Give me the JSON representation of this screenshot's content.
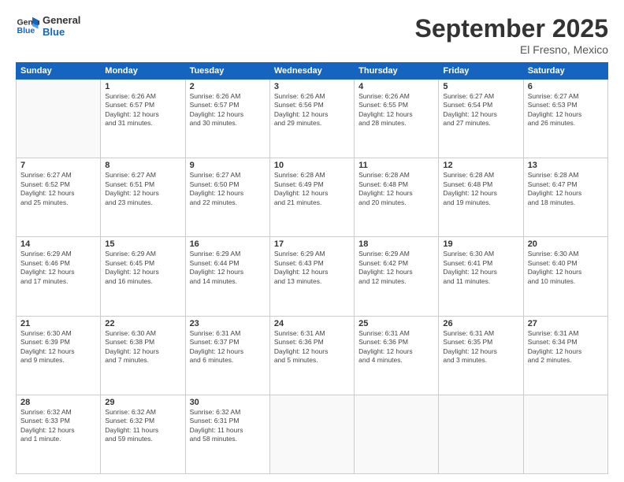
{
  "header": {
    "logo_general": "General",
    "logo_blue": "Blue",
    "month_year": "September 2025",
    "location": "El Fresno, Mexico"
  },
  "days_of_week": [
    "Sunday",
    "Monday",
    "Tuesday",
    "Wednesday",
    "Thursday",
    "Friday",
    "Saturday"
  ],
  "weeks": [
    [
      {
        "day": "",
        "info": ""
      },
      {
        "day": "1",
        "info": "Sunrise: 6:26 AM\nSunset: 6:57 PM\nDaylight: 12 hours\nand 31 minutes."
      },
      {
        "day": "2",
        "info": "Sunrise: 6:26 AM\nSunset: 6:57 PM\nDaylight: 12 hours\nand 30 minutes."
      },
      {
        "day": "3",
        "info": "Sunrise: 6:26 AM\nSunset: 6:56 PM\nDaylight: 12 hours\nand 29 minutes."
      },
      {
        "day": "4",
        "info": "Sunrise: 6:26 AM\nSunset: 6:55 PM\nDaylight: 12 hours\nand 28 minutes."
      },
      {
        "day": "5",
        "info": "Sunrise: 6:27 AM\nSunset: 6:54 PM\nDaylight: 12 hours\nand 27 minutes."
      },
      {
        "day": "6",
        "info": "Sunrise: 6:27 AM\nSunset: 6:53 PM\nDaylight: 12 hours\nand 26 minutes."
      }
    ],
    [
      {
        "day": "7",
        "info": "Sunrise: 6:27 AM\nSunset: 6:52 PM\nDaylight: 12 hours\nand 25 minutes."
      },
      {
        "day": "8",
        "info": "Sunrise: 6:27 AM\nSunset: 6:51 PM\nDaylight: 12 hours\nand 23 minutes."
      },
      {
        "day": "9",
        "info": "Sunrise: 6:27 AM\nSunset: 6:50 PM\nDaylight: 12 hours\nand 22 minutes."
      },
      {
        "day": "10",
        "info": "Sunrise: 6:28 AM\nSunset: 6:49 PM\nDaylight: 12 hours\nand 21 minutes."
      },
      {
        "day": "11",
        "info": "Sunrise: 6:28 AM\nSunset: 6:48 PM\nDaylight: 12 hours\nand 20 minutes."
      },
      {
        "day": "12",
        "info": "Sunrise: 6:28 AM\nSunset: 6:48 PM\nDaylight: 12 hours\nand 19 minutes."
      },
      {
        "day": "13",
        "info": "Sunrise: 6:28 AM\nSunset: 6:47 PM\nDaylight: 12 hours\nand 18 minutes."
      }
    ],
    [
      {
        "day": "14",
        "info": "Sunrise: 6:29 AM\nSunset: 6:46 PM\nDaylight: 12 hours\nand 17 minutes."
      },
      {
        "day": "15",
        "info": "Sunrise: 6:29 AM\nSunset: 6:45 PM\nDaylight: 12 hours\nand 16 minutes."
      },
      {
        "day": "16",
        "info": "Sunrise: 6:29 AM\nSunset: 6:44 PM\nDaylight: 12 hours\nand 14 minutes."
      },
      {
        "day": "17",
        "info": "Sunrise: 6:29 AM\nSunset: 6:43 PM\nDaylight: 12 hours\nand 13 minutes."
      },
      {
        "day": "18",
        "info": "Sunrise: 6:29 AM\nSunset: 6:42 PM\nDaylight: 12 hours\nand 12 minutes."
      },
      {
        "day": "19",
        "info": "Sunrise: 6:30 AM\nSunset: 6:41 PM\nDaylight: 12 hours\nand 11 minutes."
      },
      {
        "day": "20",
        "info": "Sunrise: 6:30 AM\nSunset: 6:40 PM\nDaylight: 12 hours\nand 10 minutes."
      }
    ],
    [
      {
        "day": "21",
        "info": "Sunrise: 6:30 AM\nSunset: 6:39 PM\nDaylight: 12 hours\nand 9 minutes."
      },
      {
        "day": "22",
        "info": "Sunrise: 6:30 AM\nSunset: 6:38 PM\nDaylight: 12 hours\nand 7 minutes."
      },
      {
        "day": "23",
        "info": "Sunrise: 6:31 AM\nSunset: 6:37 PM\nDaylight: 12 hours\nand 6 minutes."
      },
      {
        "day": "24",
        "info": "Sunrise: 6:31 AM\nSunset: 6:36 PM\nDaylight: 12 hours\nand 5 minutes."
      },
      {
        "day": "25",
        "info": "Sunrise: 6:31 AM\nSunset: 6:36 PM\nDaylight: 12 hours\nand 4 minutes."
      },
      {
        "day": "26",
        "info": "Sunrise: 6:31 AM\nSunset: 6:35 PM\nDaylight: 12 hours\nand 3 minutes."
      },
      {
        "day": "27",
        "info": "Sunrise: 6:31 AM\nSunset: 6:34 PM\nDaylight: 12 hours\nand 2 minutes."
      }
    ],
    [
      {
        "day": "28",
        "info": "Sunrise: 6:32 AM\nSunset: 6:33 PM\nDaylight: 12 hours\nand 1 minute."
      },
      {
        "day": "29",
        "info": "Sunrise: 6:32 AM\nSunset: 6:32 PM\nDaylight: 11 hours\nand 59 minutes."
      },
      {
        "day": "30",
        "info": "Sunrise: 6:32 AM\nSunset: 6:31 PM\nDaylight: 11 hours\nand 58 minutes."
      },
      {
        "day": "",
        "info": ""
      },
      {
        "day": "",
        "info": ""
      },
      {
        "day": "",
        "info": ""
      },
      {
        "day": "",
        "info": ""
      }
    ]
  ]
}
